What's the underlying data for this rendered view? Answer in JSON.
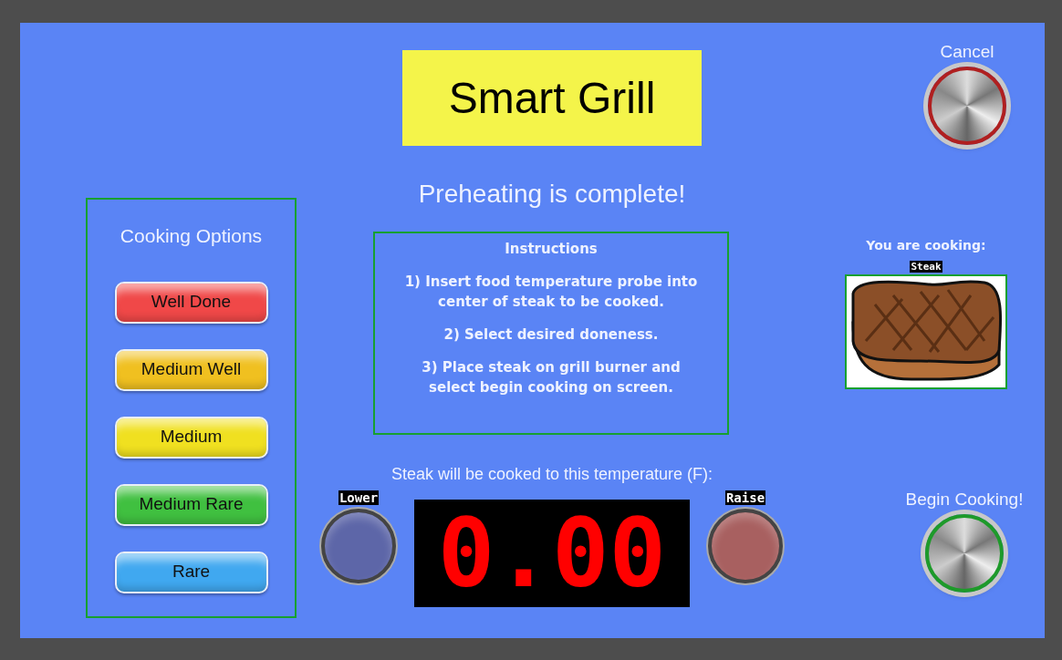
{
  "title": "Smart Grill",
  "status": "Preheating is complete!",
  "cooking_options": {
    "heading": "Cooking Options",
    "items": [
      {
        "label": "Well Done",
        "color": "#f04848"
      },
      {
        "label": "Medium Well",
        "color": "#f0c020"
      },
      {
        "label": "Medium",
        "color": "#f0e020"
      },
      {
        "label": "Medium Rare",
        "color": "#40c040"
      },
      {
        "label": "Rare",
        "color": "#40a8f0"
      }
    ]
  },
  "instructions": {
    "heading": "Instructions",
    "steps": [
      "1) Insert food temperature probe into center of steak to be cooked.",
      "2) Select desired doneness.",
      "3) Place steak on grill burner and select begin cooking on screen."
    ]
  },
  "temperature": {
    "label": "Steak will be cooked to this temperature (F):",
    "lower": "Lower",
    "raise": "Raise",
    "display": "0.00"
  },
  "cancel": {
    "label": "Cancel"
  },
  "cooking": {
    "label": "You are cooking:",
    "food": "Steak"
  },
  "begin": {
    "label": "Begin Cooking!"
  }
}
